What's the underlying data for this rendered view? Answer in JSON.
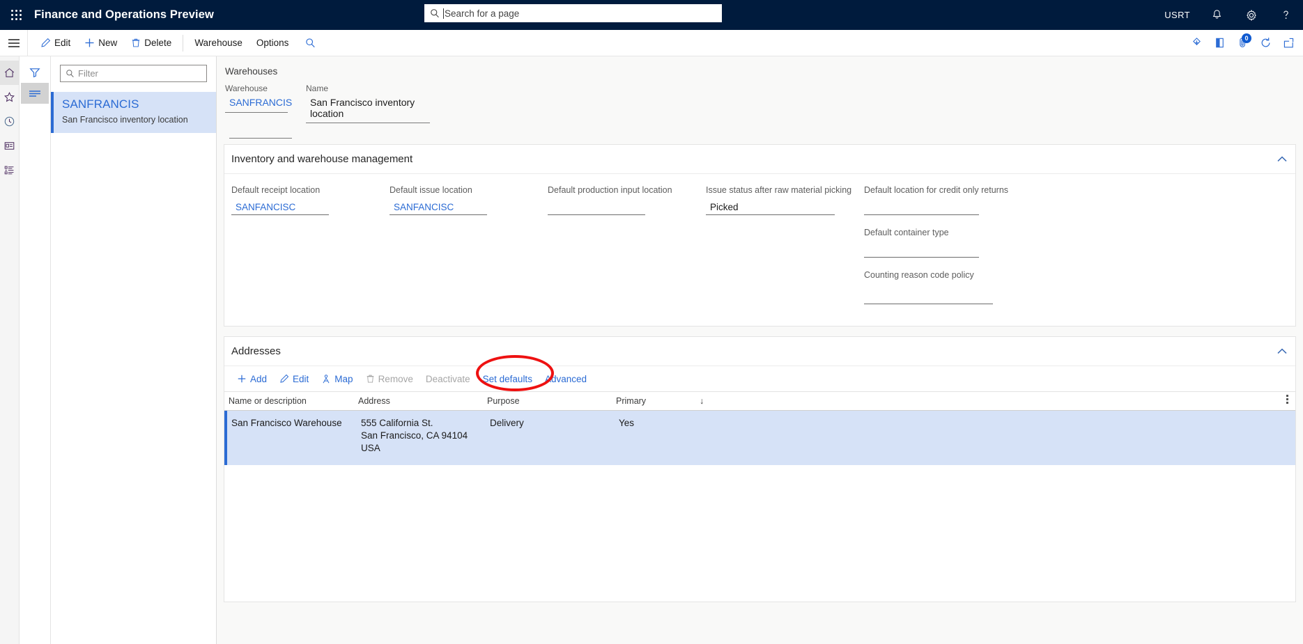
{
  "topbar": {
    "app_title": "Finance and Operations Preview",
    "waffle_icon": "app-launcher-icon",
    "search": {
      "placeholder": "Search for a page",
      "value": "",
      "icon": "search-icon"
    },
    "user_initials": "USRT",
    "notifications_icon": "bell-icon",
    "settings_icon": "gear-icon",
    "help_icon": "question-mark-icon"
  },
  "commandbar": {
    "hamburger_icon": "hamburger-menu-icon",
    "buttons": [
      {
        "label": "Edit",
        "icon": "pencil-icon"
      },
      {
        "label": "New",
        "icon": "plus-icon"
      },
      {
        "label": "Delete",
        "icon": "trash-icon"
      },
      {
        "label": "Warehouse",
        "icon": ""
      },
      {
        "label": "Options",
        "icon": ""
      }
    ],
    "search_icon": "search-icon",
    "right_icons": [
      {
        "name": "share-icon",
        "badge": ""
      },
      {
        "name": "personalize-icon",
        "badge": ""
      },
      {
        "name": "attachments-icon",
        "badge": "0"
      },
      {
        "name": "refresh-icon",
        "badge": ""
      },
      {
        "name": "open-in-new-window-icon",
        "badge": ""
      }
    ]
  },
  "rail": {
    "items": [
      {
        "name": "home-icon",
        "active": true
      },
      {
        "name": "favorites-star-icon",
        "active": false
      },
      {
        "name": "recent-clock-icon",
        "active": false
      },
      {
        "name": "workspaces-icon",
        "active": false
      },
      {
        "name": "modules-list-icon",
        "active": false
      }
    ]
  },
  "rail2": {
    "items": [
      {
        "name": "filter-funnel-icon",
        "active": false
      },
      {
        "name": "list-lines-icon",
        "active": true
      }
    ]
  },
  "listpane": {
    "filter_placeholder": "Filter",
    "filter_value": "",
    "filter_icon": "search-icon",
    "items": [
      {
        "title": "SANFRANCIS",
        "subtitle": "San Francisco inventory location",
        "selected": true
      }
    ]
  },
  "page": {
    "caption": "Warehouses",
    "header_fields": [
      {
        "label": "Warehouse",
        "value": "SANFRANCIS",
        "style": "link"
      },
      {
        "label": "Name",
        "value": "San Francisco inventory location",
        "style": "plain"
      }
    ]
  },
  "sections": {
    "inventory": {
      "title": "Inventory and warehouse management",
      "collapse_icon": "chevron-up-icon",
      "fields": {
        "default_receipt_location": {
          "label": "Default receipt location",
          "value": "SANFANCISC"
        },
        "default_issue_location": {
          "label": "Default issue location",
          "value": "SANFANCISC"
        },
        "default_production_input_location": {
          "label": "Default production input location",
          "value": ""
        },
        "issue_status_after_raw_material_picking": {
          "label": "Issue status after raw material picking",
          "value": "Picked"
        },
        "default_location_for_credit_only_returns": {
          "label": "Default location for credit only returns",
          "value": ""
        },
        "default_container_type": {
          "label": "Default container type",
          "value": ""
        },
        "counting_reason_code_policy": {
          "label": "Counting reason code policy",
          "value": ""
        }
      }
    },
    "addresses": {
      "title": "Addresses",
      "collapse_icon": "chevron-up-icon",
      "toolbar": [
        {
          "label": "Add",
          "icon": "plus-icon",
          "disabled": false
        },
        {
          "label": "Edit",
          "icon": "pencil-icon",
          "disabled": false
        },
        {
          "label": "Map",
          "icon": "map-pin-person-icon",
          "disabled": false
        },
        {
          "label": "Remove",
          "icon": "trash-icon",
          "disabled": true
        },
        {
          "label": "Deactivate",
          "icon": "",
          "disabled": true
        },
        {
          "label": "Set defaults",
          "icon": "",
          "disabled": false
        },
        {
          "label": "Advanced",
          "icon": "",
          "disabled": false
        }
      ],
      "highlighted_button": "Advanced",
      "highlight_color": "#ee1111",
      "columns": [
        {
          "label": "Name or description"
        },
        {
          "label": "Address"
        },
        {
          "label": "Purpose"
        },
        {
          "label": "Primary"
        },
        {
          "label": "↓"
        }
      ],
      "kebab_icon": "column-options-icon",
      "rows": [
        {
          "name_or_description": "San Francisco Warehouse",
          "address_line1": "555 California St.",
          "address_line2": "San Francisco, CA 94104",
          "address_line3": "USA",
          "purpose": "Delivery",
          "primary": "Yes",
          "selected": true
        }
      ]
    }
  },
  "colors": {
    "header_bg": "#001b3d",
    "accent_link": "#2b6bd4",
    "selected_row_bg": "#d6e2f7",
    "annotation": "#ee1111"
  }
}
